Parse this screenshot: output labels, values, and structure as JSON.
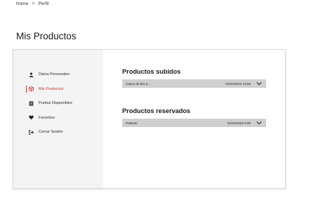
{
  "breadcrumb": {
    "home": "Home",
    "separator": ">",
    "current": "Perfil"
  },
  "page": {
    "title": "Mis Productos"
  },
  "sidebar": {
    "items": [
      {
        "label": "Datos Personales",
        "icon": "user-icon"
      },
      {
        "label": "Mis Productos",
        "icon": "box-icon",
        "active": true
      },
      {
        "label": "Puntos Disponibles",
        "icon": "points-icon"
      },
      {
        "label": "Favoritos",
        "icon": "heart-icon"
      },
      {
        "label": "Cerrar Sesión",
        "icon": "logout-icon"
      }
    ]
  },
  "uploaded": {
    "title": "Productos subidos",
    "items": [
      {
        "name": "Casco de bici p...",
        "date": "01/02/2024 13:59"
      }
    ]
  },
  "reserved": {
    "title": "Productos reservados",
    "items": [
      {
        "name": "Patinete",
        "date": "01/02/2024 9:09"
      }
    ]
  },
  "colors": {
    "accent": "#c0392b",
    "sidebar_bg": "#f4f4f4",
    "row_bg": "#cfcfcf"
  }
}
